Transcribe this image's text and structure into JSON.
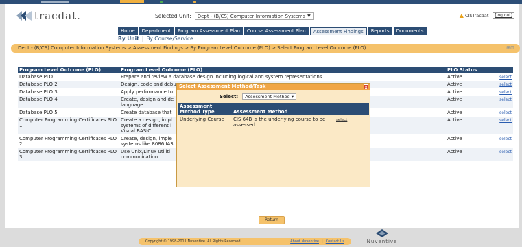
{
  "browser": {
    "title": "TracDat",
    "colors": {
      "strip": "#2d4e77"
    }
  },
  "header": {
    "logo_text": "tracdat.",
    "unit_label": "Selected Unit:",
    "unit_value": "Dept - (B/CS) Computer Information Systems",
    "user": "CISTracdat",
    "logout": "[log out]"
  },
  "tabs": [
    "Home",
    "Department",
    "Program Assessment Plan",
    "Course Assessment Plan",
    "Assessment Findings",
    "Reports",
    "Documents"
  ],
  "active_tab": "Assessment Findings",
  "subtabs": {
    "by_unit": "By Unit",
    "by_course": "By Course/Service"
  },
  "breadcrumb": "Dept - (B/CS) Computer Information Systems > Assessment Findings > By Program Level Outcome (PLO) > Select Program Level Outcome (PLO)",
  "table": {
    "headers": [
      "Program Level Outcome (PLO) Name",
      "Program Level Outcome (PLO)",
      "PLO Status",
      ""
    ],
    "rows": [
      {
        "name": "Database PLO 1",
        "plo": "Prepare and review a database design including logical and system representations",
        "status": "Active",
        "action": "select"
      },
      {
        "name": "Database PLO 2",
        "plo": "Design, code and debug",
        "status": "Active",
        "action": "select"
      },
      {
        "name": "Database PLO 3",
        "plo": "Apply performance tu",
        "status": "Active",
        "action": "select"
      },
      {
        "name": "Database PLO 4",
        "plo": "Create, design and de\nlanguage",
        "status": "Active",
        "action": "select"
      },
      {
        "name": "Database PLO 5",
        "plo": "Create database that",
        "status": "Active",
        "action": "select"
      },
      {
        "name": "Computer Programming Certificates PLO 1",
        "plo": "Create a design, impl\nsystems of different l\nVisual BASIC.",
        "status": "Active",
        "action": "select"
      },
      {
        "name": "Computer Programming Certificates PLO 2",
        "plo": "Create, design, imple\nsystems like 8086 IA3",
        "status": "Active",
        "action": "select"
      },
      {
        "name": "Computer Programming Certificates PLO 3",
        "plo": "Use Unix/Linux utiliti\ncommunication",
        "status": "Active",
        "action": "select"
      }
    ]
  },
  "modal": {
    "title": "Select Assessment Method/Task",
    "select_label": "Select:",
    "select_value": "Assessment Method",
    "headers": [
      "Assessment Method Type",
      "Assessment Method"
    ],
    "rows": [
      {
        "type": "Underlying Course",
        "method": "CIS 64B is the underlying course to be assessed.",
        "action": "select"
      }
    ]
  },
  "return_label": "Return",
  "footer": {
    "copyright": "Copyright © 1998-2011 Nuventive. All Rights Reserved",
    "about": "About Nuventive",
    "sep": "|",
    "contact": "Contact Us",
    "brand": "Nuventive"
  }
}
